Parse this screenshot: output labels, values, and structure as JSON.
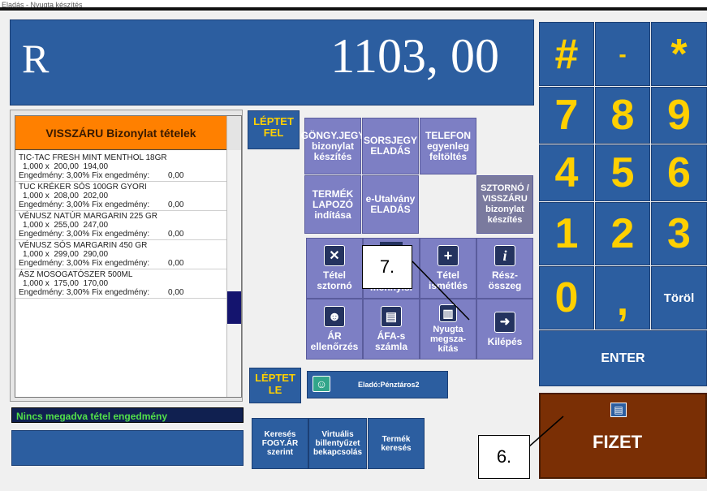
{
  "window": {
    "title": "Eladás - Nyugta készítés"
  },
  "display": {
    "currency": "R",
    "amount": "1103, 00"
  },
  "list": {
    "header": "VISSZÁRU Bizonylat tételek",
    "items": [
      {
        "name": "TIC-TAC FRESH MINT MENTHOL 18GR",
        "qty": "1,000 x",
        "price": "200,00",
        "total": "194,00",
        "discount_label": "Engedmény: 3,00%",
        "fix_label": "Fix engedmény:",
        "fix": "0,00"
      },
      {
        "name": "TUC KRÉKER SÓS 100GR GYORI",
        "qty": "1,000 x",
        "price": "208,00",
        "total": "202,00",
        "discount_label": "Engedmény: 3,00%",
        "fix_label": "Fix engedmény:",
        "fix": "0,00"
      },
      {
        "name": "VÉNUSZ NATÚR MARGARIN 225 GR",
        "qty": "1,000 x",
        "price": "255,00",
        "total": "247,00",
        "discount_label": "Engedmény: 3,00%",
        "fix_label": "Fix engedmény:",
        "fix": "0,00"
      },
      {
        "name": "VÉNUSZ SÓS MARGARIN 450 GR",
        "qty": "1,000 x",
        "price": "299,00",
        "total": "290,00",
        "discount_label": "Engedmény: 3,00%",
        "fix_label": "Fix engedmény:",
        "fix": "0,00"
      },
      {
        "name": "ÁSZ MOSOGATÓSZER 500ML",
        "qty": "1,000 x",
        "price": "175,00",
        "total": "170,00",
        "discount_label": "Engedmény: 3,00%",
        "fix_label": "Fix engedmény:",
        "fix": "0,00"
      }
    ]
  },
  "nav": {
    "up_line1": "LÉPTET",
    "up_line2": "FEL",
    "down_line1": "LÉPTET",
    "down_line2": "LE"
  },
  "functions": {
    "gongy_1": "GÖNGY.JEGY",
    "gongy_2": "bizonylat",
    "gongy_3": "készítés",
    "sors_1": "SORSJEGY",
    "sors_2": "ELADÁS",
    "tel_1": "TELEFON",
    "tel_2": "egyenleg",
    "tel_3": "feltöltés",
    "termek_1": "TERMÉK",
    "termek_2": "LAPOZÓ",
    "termek_3": "indítása",
    "eutal_1": "e-Utalvány",
    "eutal_2": "ELADÁS",
    "sztorno_1": "SZTORNÓ /",
    "sztorno_2": "VISSZÁRU",
    "sztorno_3": "bizonylat",
    "sztorno_4": "készítés"
  },
  "actions": {
    "tetel_sztorno_1": "Tétel",
    "tetel_sztorno_2": "sztornó",
    "mennyiseg_partial": "mennyis.",
    "tetel_ism_1": "Tétel",
    "tetel_ism_2": "ismétlés",
    "resz_1": "Rész-",
    "resz_2": "összeg",
    "ar_1": "ÁR",
    "ar_2": "ellenőrzés",
    "afa_1": "ÁFA-s",
    "afa_2": "számla",
    "nyugta_1": "Nyugta",
    "nyugta_2": "megsza-",
    "nyugta_3": "kítás",
    "kilepes": "Kilépés"
  },
  "seller": {
    "label": "Eladó:Pénztáros2"
  },
  "status": {
    "text": "Nincs megadva tétel engedmény"
  },
  "bottom": {
    "kereses_1": "Keresés",
    "kereses_2": "FOGY.ÁR",
    "kereses_3": "szerint",
    "virt_1": "Virtuális",
    "virt_2": "billentyűzet",
    "virt_3": "bekapcsolás",
    "termker_1": "Termék",
    "termker_2": "keresés"
  },
  "keypad": {
    "k_hash": "#",
    "k_minus": "-",
    "k_star": "*",
    "k7": "7",
    "k8": "8",
    "k9": "9",
    "k4": "4",
    "k5": "5",
    "k6": "6",
    "k1": "1",
    "k2": "2",
    "k3": "3",
    "k0": "0",
    "k_comma": ",",
    "clear": "Töröl",
    "enter": "ENTER"
  },
  "pay": {
    "label": "FIZET"
  },
  "callouts": {
    "c6": "6.",
    "c7": "7."
  },
  "colors": {
    "panel_blue": "#2c5ea0",
    "function_purple": "#7d7fc4",
    "digit_yellow": "#ffd000",
    "list_header_orange": "#ff8000",
    "pay_brown": "#7a2f05",
    "status_green": "#52e04a"
  }
}
